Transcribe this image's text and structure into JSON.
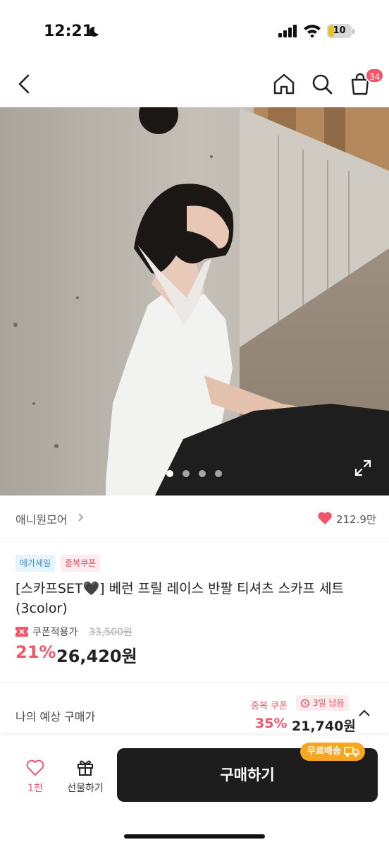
{
  "status_bar": {
    "time": "12:21",
    "battery": "10"
  },
  "nav": {
    "cart_count": "34"
  },
  "gallery": {
    "total_images": 4,
    "active_index": 0
  },
  "brand": {
    "name": "애니원모어",
    "likes": "212.9만"
  },
  "product": {
    "badges": [
      "메가세일",
      "중복쿠폰"
    ],
    "title": "[스카프SET🖤] 베런 프릴 레이스 반팔 티셔츠 스카프 세트 (3color)",
    "coupon_label": "쿠폰적용가",
    "original_price": "33,500원",
    "discount": "21%",
    "price": "26,420원"
  },
  "expected": {
    "label": "나의 예상 구매가",
    "dup_coupon": "중복 쿠폰",
    "days_left": "3일 남음",
    "discount": "35%",
    "price": "21,740원"
  },
  "bottom": {
    "like_label": "1천",
    "gift_label": "선물하기",
    "buy_label": "구매하기",
    "shipping_label": "무료배송"
  },
  "colors": {
    "accent": "#f2566b",
    "buy_button": "#1d1d1d",
    "shipping": "#f5a623"
  }
}
